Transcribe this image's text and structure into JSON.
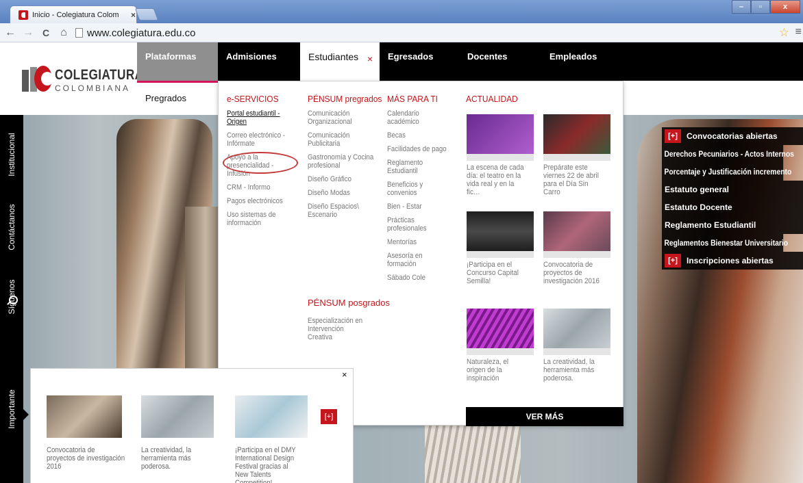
{
  "browser": {
    "tab_title": "Inicio - Colegiatura Colom",
    "tab_close": "×",
    "url": "www.colegiatura.edu.co",
    "back": "←",
    "forward": "→",
    "reload": "C",
    "home": "⌂",
    "star": "☆",
    "menu": "≡",
    "win_min": "–",
    "win_max": "▫",
    "win_close": "x"
  },
  "logo": {
    "line1": "COLEGIATURA",
    "line2": "COLOMBIANA"
  },
  "topnav": {
    "plataformas": "Plataformas",
    "admisiones": "Admisiones",
    "estudiantes": "Estudiantes",
    "estudiantes_close": "×",
    "egresados": "Egresados",
    "docentes": "Docentes",
    "empleados": "Empleados"
  },
  "subnav": {
    "pregrados": "Pregrados"
  },
  "sidebar": {
    "institucional": "Institucional",
    "contactanos": "Contáctanos",
    "siguenos": "Síguenos",
    "importante": "Importante"
  },
  "mega": {
    "eservicios": {
      "heading": "e-SERVICIOS",
      "items": [
        "Portal estudiantil - Origen",
        "Correo electrónico - Infórmate",
        "Apoyo a la presencialidad - Infusión",
        "CRM - Informo",
        "Pagos electrónicos",
        "Uso sistemas de información"
      ]
    },
    "pensum_pregrados": {
      "heading": "PÉNSUM pregrados",
      "items": [
        "Comunicación Organizacional",
        "Comunicación Publicitaria",
        "Gastronomía y Cocina profesional",
        "Diseño Gráfico",
        "Diseño Modas",
        "Diseño Espacios\\ Escenario"
      ]
    },
    "pensum_posgrados": {
      "heading": "PÉNSUM posgrados",
      "items": [
        "Especialización en Intervención Creativa"
      ]
    },
    "mas_para_ti": {
      "heading": "MÁS PARA TI",
      "items": [
        "Calendario académico",
        "Becas",
        "Facilidades de pago",
        "Reglamento Estudiantil",
        "Beneficios y convenios",
        "Bien - Estar",
        "Prácticas profesionales",
        "Mentorías",
        "Asesoría en formación",
        "Sábado Cole"
      ]
    },
    "actualidad": {
      "heading": "ACTUALIDAD",
      "news": [
        "La escena de cada día: el teatro en la vida real y en la fic…",
        "Prepárate este viernes 22 de abril para el Día Sin Carro",
        "¡Participa en el Concurso Capital Semilla!",
        "Convocatoria de proyectos de investigación 2016",
        "Naturaleza, el origen de la inspiración",
        "La creatividad, la herramienta más poderosa."
      ],
      "ver_mas": "VER MÁS"
    }
  },
  "convocatorias": {
    "plus": "[+]",
    "title": "Convocatorias abiertas",
    "links": [
      "Derechos Pecuniarios - Actos Internos",
      "Porcentaje y Justificación incremento",
      "Estatuto general",
      "Estatuto Docente",
      "Reglamento Estudiantil",
      "Reglamentos Bienestar Universitario"
    ],
    "inscripciones": "Inscripciones abiertas"
  },
  "importante_popup": {
    "close": "×",
    "plus": "[+]",
    "cards": [
      "Convocatoria de proyectos de investigación 2016",
      "La creatividad, la herramienta más poderosa.",
      "¡Participa en el DMY International Design Festival gracias al New Talents Competition!"
    ]
  }
}
